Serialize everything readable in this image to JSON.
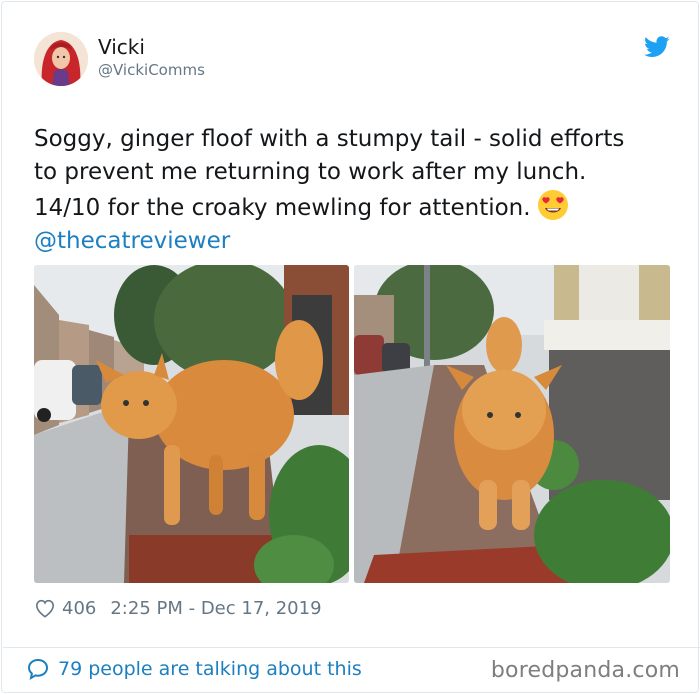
{
  "tweet": {
    "display_name": "Vicki",
    "handle": "@VickiComms",
    "text_lines": [
      "Soggy, ginger floof with a stumpy tail - solid efforts",
      "to prevent me returning to work after my lunch.",
      "14/10 for the croaky mewling for attention."
    ],
    "mention": "@thecatreviewer",
    "like_count": "406",
    "timestamp": "2:25 PM - Dec 17, 2019",
    "talking_text": "79 people are talking about this"
  },
  "watermark": "boredpanda.com",
  "icons": {
    "twitter": "twitter-bird-icon",
    "heart": "heart-outline-icon",
    "comment": "speech-bubble-icon",
    "emoji": "heart-eyes-emoji"
  },
  "colors": {
    "link": "#1b7fc0",
    "twitter_blue": "#1da1f2",
    "muted": "#657786",
    "text": "#14171a"
  }
}
